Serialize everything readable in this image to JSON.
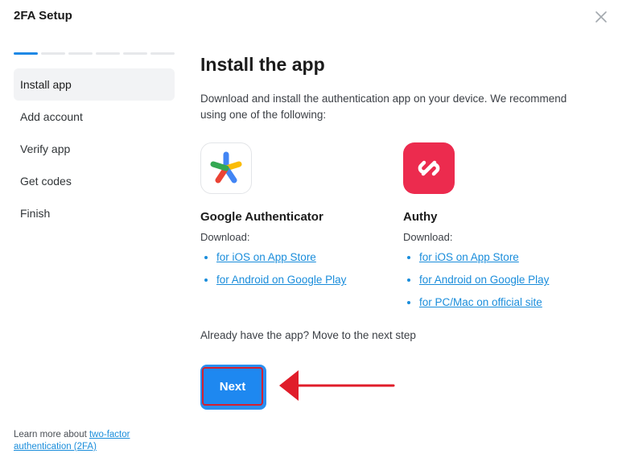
{
  "header": {
    "title": "2FA Setup"
  },
  "progress": {
    "total": 6,
    "current": 1
  },
  "steps": [
    {
      "label": "Install app",
      "active": true
    },
    {
      "label": "Add account",
      "active": false
    },
    {
      "label": "Verify app",
      "active": false
    },
    {
      "label": "Get codes",
      "active": false
    },
    {
      "label": "Finish",
      "active": false
    }
  ],
  "learn_more": {
    "prefix": "Learn more about ",
    "link": "two-factor authentication (2FA)"
  },
  "main": {
    "title": "Install the app",
    "intro": "Download and install the authentication app on your device. We recommend using one of the following:",
    "apps": [
      {
        "name": "Google Authenticator",
        "download_label": "Download:",
        "links": [
          "for iOS on App Store",
          "for Android on Google Play"
        ]
      },
      {
        "name": "Authy",
        "download_label": "Download:",
        "links": [
          "for iOS on App Store",
          "for Android on Google Play",
          "for PC/Mac on official site"
        ]
      }
    ],
    "already": "Already have the app? Move to the next step",
    "next_label": "Next"
  },
  "colors": {
    "accent": "#1e88f0",
    "highlight_border": "#d42030",
    "arrow": "#e01d2a",
    "authy_brand": "#ec2b4e"
  }
}
